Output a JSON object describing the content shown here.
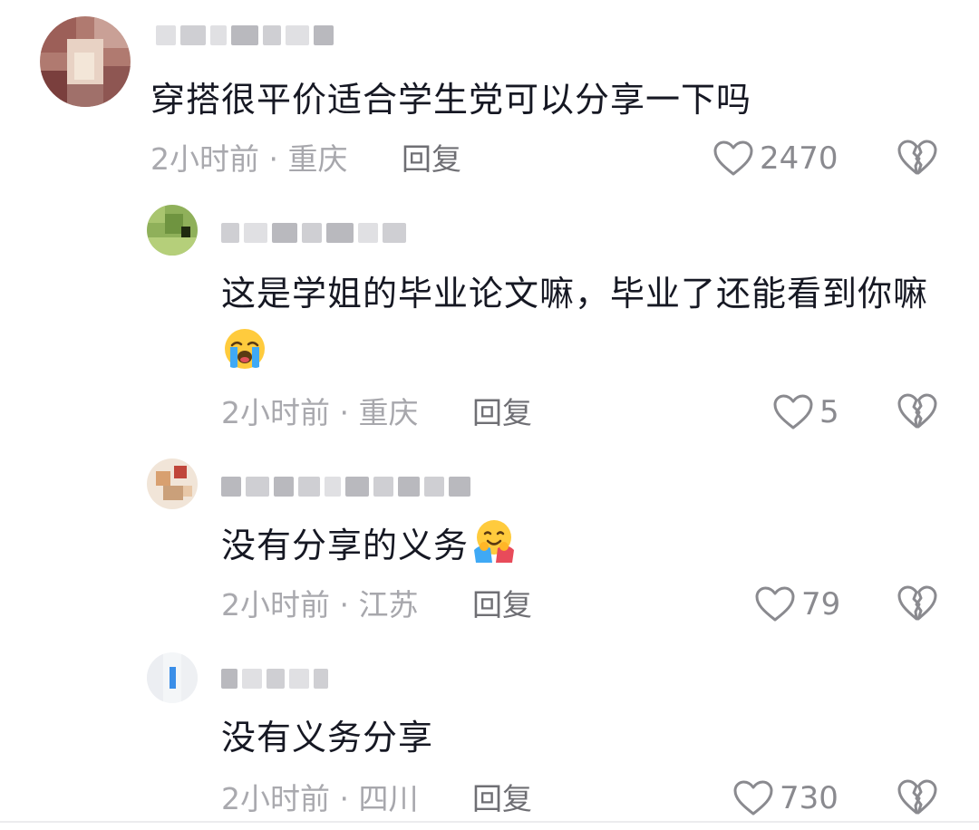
{
  "comments": [
    {
      "text": "穿搭很平价适合学生党可以分享一下吗",
      "time": "2小时前",
      "location": "重庆",
      "reply_label": "回复",
      "likes": "2470"
    },
    {
      "text": "这是学姐的毕业论文嘛，毕业了还能看到你嘛",
      "emoji": "loudly-crying-face-emoji",
      "time": "2小时前",
      "location": "重庆",
      "reply_label": "回复",
      "likes": "5"
    },
    {
      "text": "没有分享的义务",
      "emoji": "hugging-face-emoji",
      "time": "2小时前",
      "location": "江苏",
      "reply_label": "回复",
      "likes": "79"
    },
    {
      "text": "没有义务分享",
      "time": "2小时前",
      "location": "四川",
      "reply_label": "回复",
      "likes": "730"
    }
  ],
  "separator": "·",
  "icons": {
    "like": "heart-outline-icon",
    "dislike": "broken-heart-icon"
  },
  "colors": {
    "text": "#161823",
    "meta": "#a7a7ac",
    "reply": "#6f6f74",
    "icon": "#8a8a8f"
  }
}
